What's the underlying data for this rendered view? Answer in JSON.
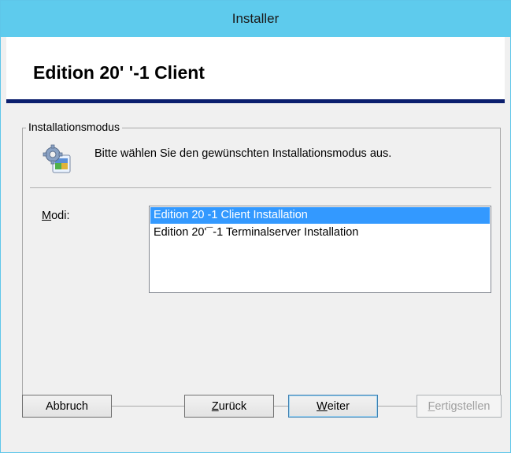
{
  "window": {
    "title": "Installer"
  },
  "header": {
    "title": "Edition 20' '-1 Client"
  },
  "group": {
    "legend": "Installationsmodus",
    "prompt": "Bitte wählen Sie den gewünschten Installationsmodus aus.",
    "icon": "setup-gear-icon"
  },
  "modes": {
    "label": "Modi:",
    "items": [
      {
        "label": "Edition 20 -1 Client Installation",
        "selected": true
      },
      {
        "label": "Edition 20'¯-1 Terminalserver Installation",
        "selected": false
      }
    ]
  },
  "buttons": {
    "cancel": "Abbruch",
    "back": "Zurück",
    "next": "Weiter",
    "finish": "Fertigstellen"
  },
  "colors": {
    "titlebar": "#5ecbed",
    "header_rule": "#0b1f6e",
    "selection": "#3399ff"
  }
}
